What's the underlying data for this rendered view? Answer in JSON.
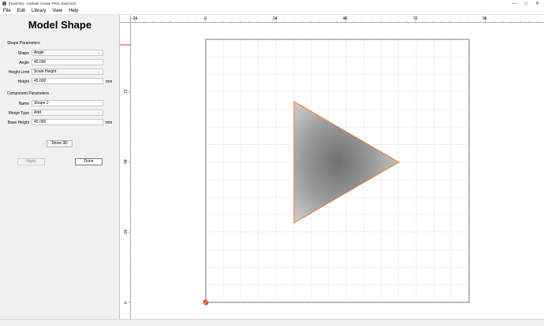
{
  "window": {
    "title": "[NewFile] - Carbide Create PRO, Build 632",
    "minimize": "—",
    "maximize": "□",
    "close": "✕"
  },
  "menu": {
    "file": "File",
    "edit": "Edit",
    "library": "Library",
    "view": "View",
    "help": "Help"
  },
  "panel": {
    "title": "Model Shape",
    "shape_params_title": "Shape Parameters",
    "shape_label": "Shape",
    "shape_value": "Angle",
    "angle_label": "Angle",
    "angle_value": "45.000",
    "height_limit_label": "Height Limit",
    "height_limit_value": "Scale Height",
    "height_label": "Height",
    "height_value": "45.000",
    "height_unit": "mm",
    "component_params_title": "Component Parameters",
    "name_label": "Name",
    "name_value": "Shape 2",
    "merge_type_label": "Merge Type",
    "merge_type_value": "Add",
    "base_height_label": "Base Height",
    "base_height_value": "45.000",
    "base_height_unit": "mm",
    "show3d_label": "Show 3D",
    "apply_label": "Apply",
    "done_label": "Done"
  },
  "ruler": {
    "h_ticks": [
      "-24",
      "0",
      "24",
      "48",
      "72",
      "96"
    ],
    "v_ticks": [
      "72",
      "48",
      "24",
      "0"
    ]
  },
  "colors": {
    "shape_outline": "#f07a30",
    "origin_marker": "#e53b2c",
    "grid": "#dedede"
  }
}
